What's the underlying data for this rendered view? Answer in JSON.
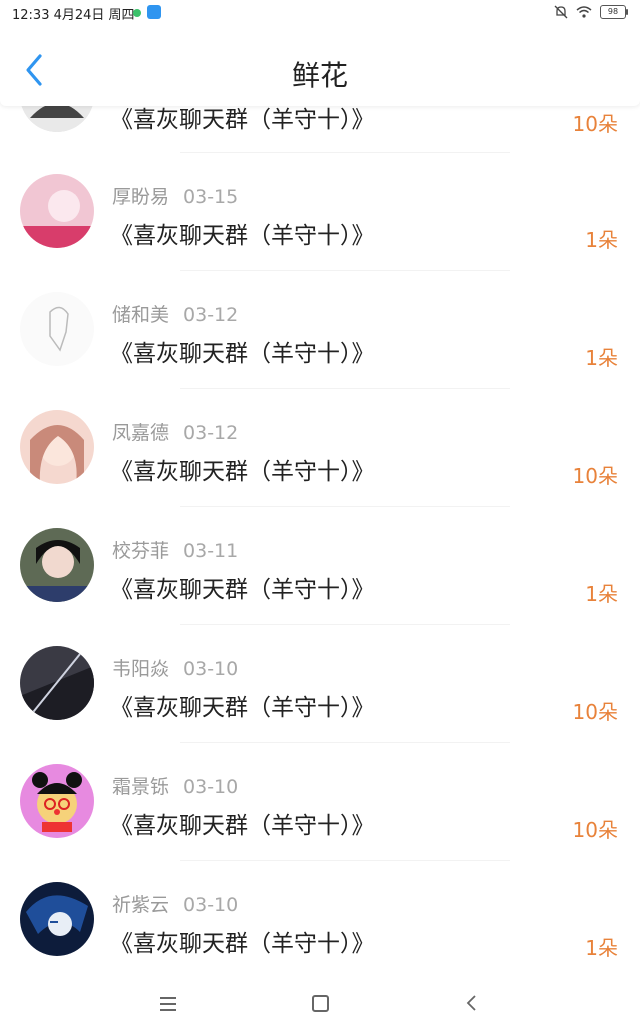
{
  "status": {
    "time": "12:33 4月24日 周四",
    "battery": "98"
  },
  "header": {
    "title": "鲜花"
  },
  "colors": {
    "accent_back": "#2f95f0",
    "amount": "#e8823a"
  },
  "list": {
    "partial": {
      "book": "《喜灰聊天群（羊守十）》",
      "amount": "10朵"
    },
    "items": [
      {
        "user": "厚盼易",
        "date": "03-15",
        "book": "《喜灰聊天群（羊守十）》",
        "amount": "1朵"
      },
      {
        "user": "储和美",
        "date": "03-12",
        "book": "《喜灰聊天群（羊守十）》",
        "amount": "1朵"
      },
      {
        "user": "凤嘉德",
        "date": "03-12",
        "book": "《喜灰聊天群（羊守十）》",
        "amount": "10朵"
      },
      {
        "user": "校芬菲",
        "date": "03-11",
        "book": "《喜灰聊天群（羊守十）》",
        "amount": "1朵"
      },
      {
        "user": "韦阳焱",
        "date": "03-10",
        "book": "《喜灰聊天群（羊守十）》",
        "amount": "10朵"
      },
      {
        "user": "霜景铄",
        "date": "03-10",
        "book": "《喜灰聊天群（羊守十）》",
        "amount": "10朵"
      },
      {
        "user": "祈紫云",
        "date": "03-10",
        "book": "《喜灰聊天群（羊守十）》",
        "amount": "1朵"
      }
    ]
  },
  "navbar": {
    "menu_icon": "menu-icon",
    "home_icon": "home-icon",
    "back_icon": "back-icon"
  }
}
